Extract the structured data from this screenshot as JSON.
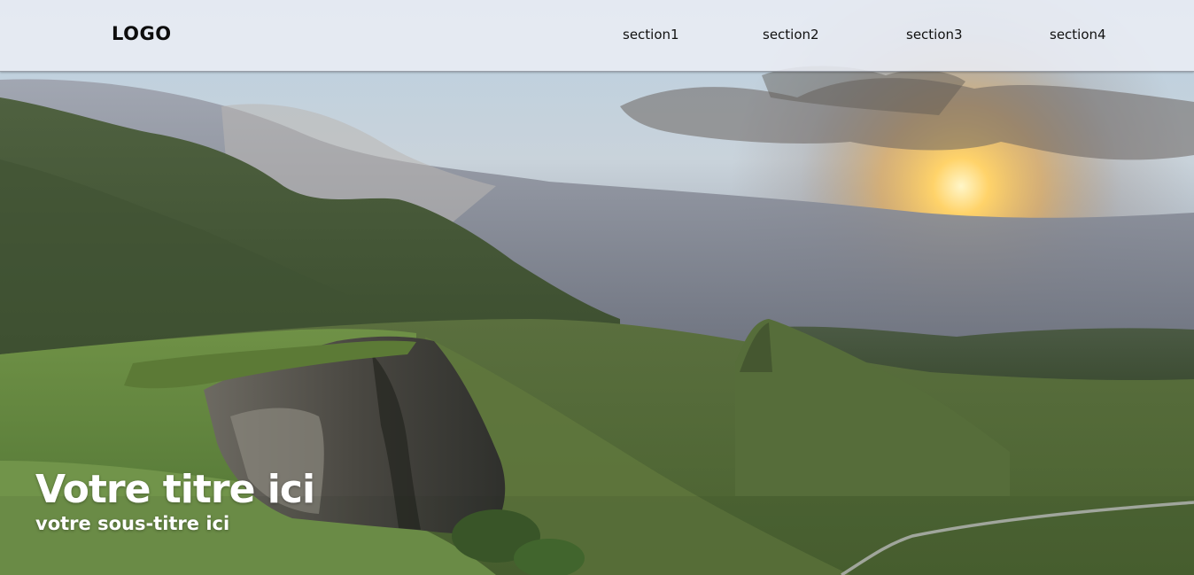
{
  "header": {
    "logo": "LOGO",
    "nav": [
      {
        "label": "section1"
      },
      {
        "label": "section2"
      },
      {
        "label": "section3"
      },
      {
        "label": "section4"
      }
    ]
  },
  "hero": {
    "title": "Votre titre ici",
    "subtitle": "votre sous-titre ici"
  },
  "colors": {
    "header_bg": "#ebeef4",
    "text_dark": "#111111",
    "hero_text": "#ffffff"
  }
}
